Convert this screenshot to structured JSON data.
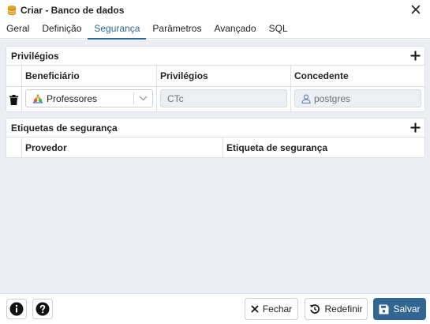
{
  "window": {
    "title": "Criar - Banco de dados"
  },
  "tabs": [
    {
      "label": "Geral"
    },
    {
      "label": "Definição"
    },
    {
      "label": "Segurança"
    },
    {
      "label": "Parâmetros"
    },
    {
      "label": "Avançado"
    },
    {
      "label": "SQL"
    }
  ],
  "active_tab": "Segurança",
  "privileges": {
    "title": "Privilégios",
    "columns": [
      "Beneficiário",
      "Privilégios",
      "Concedente"
    ],
    "rows": [
      {
        "grantee": "Professores",
        "privileges": "CTc",
        "grantor": "postgres"
      }
    ]
  },
  "security_labels": {
    "title": "Etiquetas de segurança",
    "columns": [
      "Provedor",
      "Etiqueta de segurança"
    ]
  },
  "footer": {
    "close_label": "Fechar",
    "reset_label": "Redefinir",
    "save_label": "Salvar"
  },
  "colors": {
    "accent": "#326690",
    "panel_background": "#ebeef3",
    "border": "#dde0e6"
  }
}
